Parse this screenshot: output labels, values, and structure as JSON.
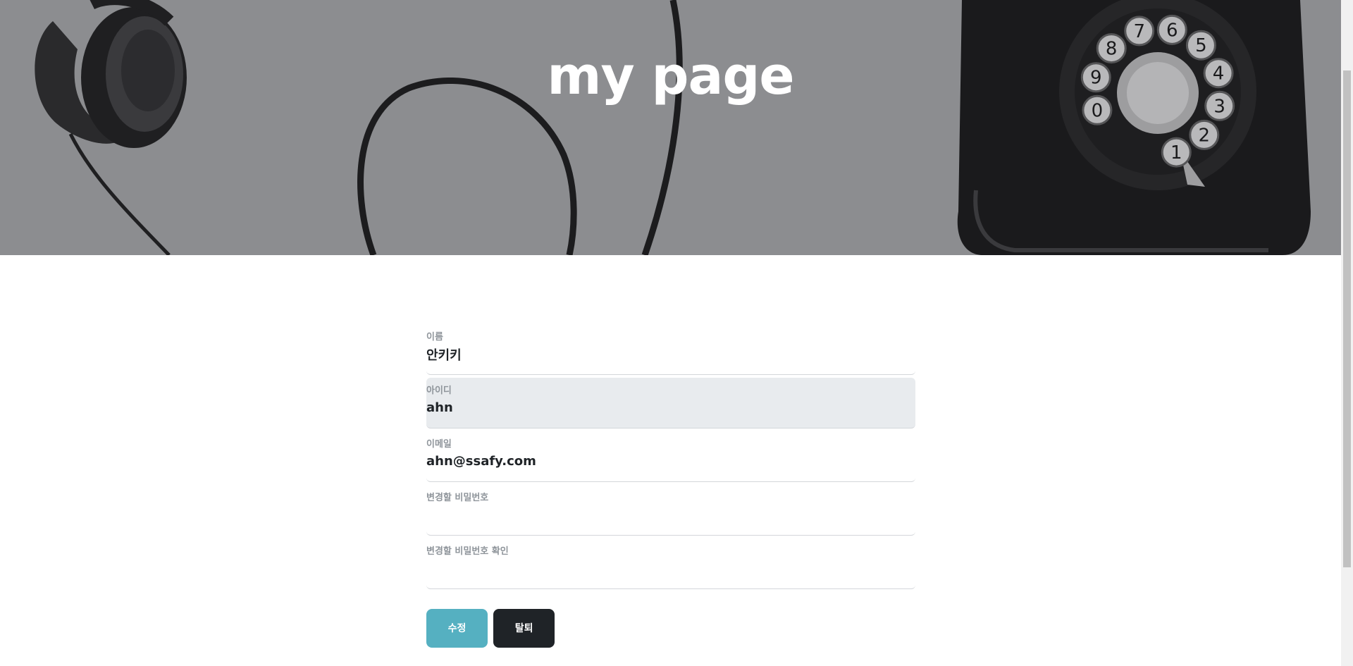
{
  "hero": {
    "title": "my page",
    "background_color": "#8c8d90"
  },
  "form": {
    "fields": [
      {
        "label": "이름",
        "value": "안키키",
        "disabled": false
      },
      {
        "label": "아이디",
        "value": "ahn",
        "disabled": true
      },
      {
        "label": "이메일",
        "value": "ahn@ssafy.com",
        "disabled": false
      },
      {
        "label": "변경할 비밀번호",
        "value": "",
        "disabled": false
      },
      {
        "label": "변경할 비밀번호 확인",
        "value": "",
        "disabled": false
      }
    ]
  },
  "buttons": {
    "edit_label": "수정",
    "delete_label": "탈퇴",
    "edit_color": "#55b0c1",
    "delete_color": "#1f2327"
  },
  "rotary_dial": {
    "digits": [
      "1",
      "2",
      "3",
      "4",
      "5",
      "6",
      "7",
      "8",
      "9",
      "0"
    ]
  }
}
